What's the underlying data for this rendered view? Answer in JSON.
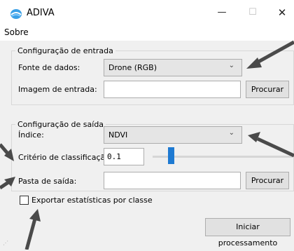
{
  "window": {
    "title": "ADIVA",
    "minimize": "—",
    "maximize": "☐",
    "close": "✕"
  },
  "menu": {
    "items": [
      "Sobre"
    ]
  },
  "input_group": {
    "title": "Configuração de entrada",
    "source_label": "Fonte de dados:",
    "source_value": "Drone (RGB)",
    "image_label": "Imagem de entrada:",
    "image_value": "",
    "browse_label": "Procurar"
  },
  "output_group": {
    "title": "Configuração de saída",
    "index_label": "Índice:",
    "index_value": "NDVI",
    "criterion_label": "Critério de classificação:",
    "criterion_value": "0.1",
    "slider_level": 0.1,
    "folder_label": "Pasta de saída:",
    "folder_value": "",
    "browse_label": "Procurar"
  },
  "export_checkbox": {
    "label": "Exportar estatísticas por classe",
    "checked": false
  },
  "start_button": "Iniciar processamento",
  "colors": {
    "accent": "#1e7ad2",
    "arrow": "#4a4a4a"
  }
}
